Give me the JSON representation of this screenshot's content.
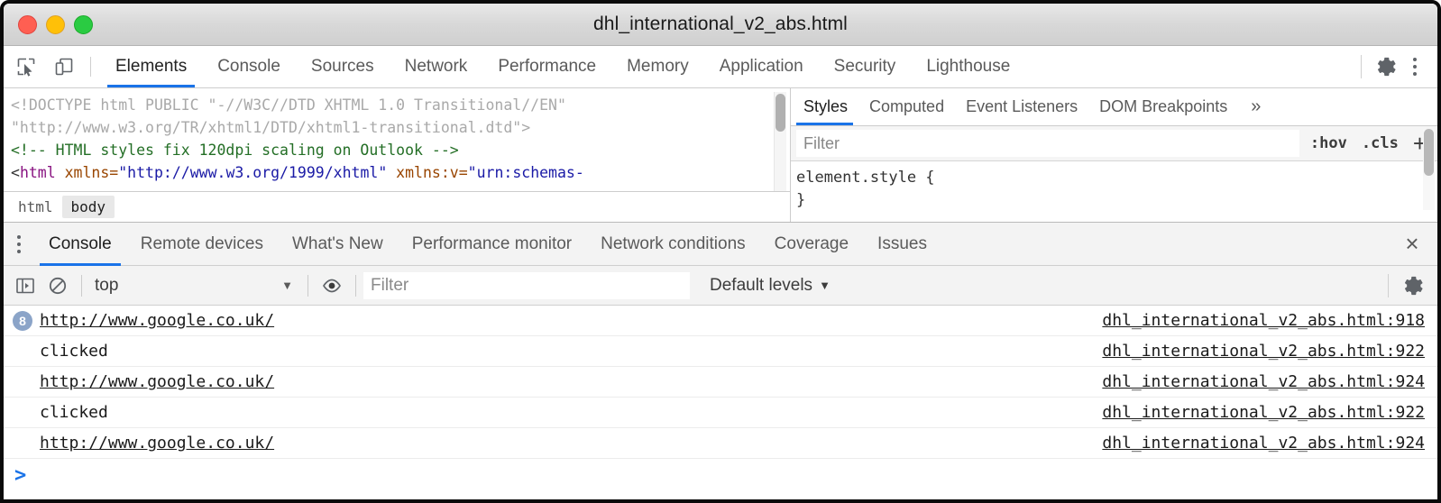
{
  "window": {
    "title": "dhl_international_v2_abs.html",
    "traffic_lights": [
      "close-button",
      "minimize-button",
      "maximize-button"
    ]
  },
  "devtools": {
    "toolbar_icons": [
      "inspect-element-icon",
      "device-toolbar-icon"
    ],
    "tabs": [
      {
        "label": "Elements",
        "active": true
      },
      {
        "label": "Console",
        "active": false
      },
      {
        "label": "Sources",
        "active": false
      },
      {
        "label": "Network",
        "active": false
      },
      {
        "label": "Performance",
        "active": false
      },
      {
        "label": "Memory",
        "active": false
      },
      {
        "label": "Application",
        "active": false
      },
      {
        "label": "Security",
        "active": false
      },
      {
        "label": "Lighthouse",
        "active": false
      }
    ],
    "settings_icon": "gear-icon",
    "more_icon": "kebab-menu-icon"
  },
  "elements_panel": {
    "dom_lines": [
      {
        "type": "doctype",
        "part1": "<!DOCTYPE html PUBLIC \"-//W3C//DTD XHTML 1.0 Transitional//EN\""
      },
      {
        "type": "doctype",
        "part1": "\"http://www.w3.org/TR/xhtml1/DTD/xhtml1-transitional.dtd\">"
      },
      {
        "type": "comment",
        "part1": "<!-- HTML styles fix 120dpi scaling on Outlook -->"
      }
    ],
    "html_line": {
      "open": "<html",
      "attr1": " xmlns=",
      "val1": "\"http://www.w3.org/1999/xhtml\"",
      "attr2": " xmlns:v=",
      "val2": "\"urn:schemas-"
    },
    "breadcrumb": [
      {
        "label": "html",
        "selected": false
      },
      {
        "label": "body",
        "selected": true
      }
    ]
  },
  "styles_panel": {
    "tabs": [
      {
        "label": "Styles",
        "active": true
      },
      {
        "label": "Computed",
        "active": false
      },
      {
        "label": "Event Listeners",
        "active": false
      },
      {
        "label": "DOM Breakpoints",
        "active": false
      }
    ],
    "more_label": "»",
    "filter_placeholder": "Filter",
    "filter_value": "",
    "hov_label": ":hov",
    "cls_label": ".cls",
    "new_rule_label": "+",
    "rule_selector": "element.style {",
    "rule_close": "}"
  },
  "drawer": {
    "menu_icon": "kebab-menu-icon",
    "tabs": [
      {
        "label": "Console",
        "active": true
      },
      {
        "label": "Remote devices",
        "active": false
      },
      {
        "label": "What's New",
        "active": false
      },
      {
        "label": "Performance monitor",
        "active": false
      },
      {
        "label": "Network conditions",
        "active": false
      },
      {
        "label": "Coverage",
        "active": false
      },
      {
        "label": "Issues",
        "active": false
      }
    ],
    "close_label": "×"
  },
  "console_toolbar": {
    "sidebar_icon": "console-sidebar-icon",
    "clear_icon": "clear-console-icon",
    "context": "top",
    "context_caret": "▼",
    "eye_icon": "live-expression-icon",
    "filter_placeholder": "Filter",
    "filter_value": "",
    "levels_label": "Default levels",
    "levels_caret": "▼",
    "settings_icon": "gear-icon"
  },
  "console_messages": [
    {
      "badge": "8",
      "text": "http://www.google.co.uk/",
      "is_link": true,
      "source": "dhl_international_v2_abs.html:918"
    },
    {
      "badge": "",
      "text": "clicked",
      "is_link": false,
      "source": "dhl_international_v2_abs.html:922"
    },
    {
      "badge": "",
      "text": "http://www.google.co.uk/",
      "is_link": true,
      "source": "dhl_international_v2_abs.html:924"
    },
    {
      "badge": "",
      "text": "clicked",
      "is_link": false,
      "source": "dhl_international_v2_abs.html:922"
    },
    {
      "badge": "",
      "text": "http://www.google.co.uk/",
      "is_link": true,
      "source": "dhl_international_v2_abs.html:924"
    }
  ],
  "console_prompt": {
    "caret": ">",
    "value": ""
  },
  "colors": {
    "accent_blue": "#1a73e8",
    "badge_blue": "#8ba4c8",
    "tag_purple": "#881280",
    "attr_orange": "#994500",
    "value_blue": "#1a1aa6",
    "comment_green": "#236e25"
  }
}
